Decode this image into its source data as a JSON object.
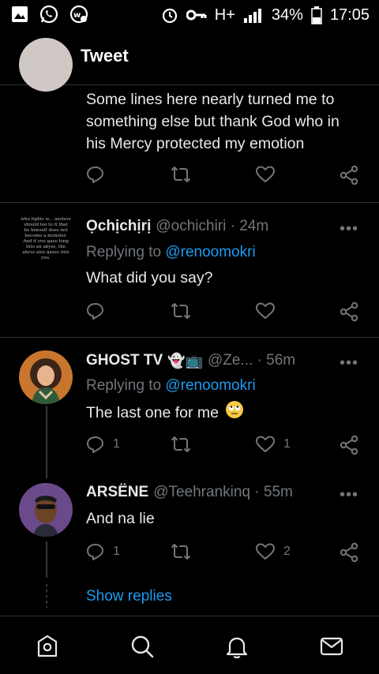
{
  "status_bar": {
    "battery_percent": "34%",
    "time": "17:05",
    "network": "H+"
  },
  "header": {
    "title": "Tweet"
  },
  "tweets": [
    {
      "body": "Some lines here nearly turned me to something else but thank God who in his Mercy protected my emotion"
    },
    {
      "name": "Ọchịchịrị",
      "handle": "@ochichiri · 24m",
      "replying_prefix": "Replying to ",
      "replying_to": "@renoomokri",
      "body": "What did you say?",
      "avatar_text": "who fights w... onsters should loo to it that he himself does not become a monster. And if you gaze long into an abyss, the abyss also gazes into you."
    },
    {
      "name": "GHOST TV",
      "name_emoji": "👻📺",
      "handle": "@Ze... · 56m",
      "replying_prefix": "Replying to ",
      "replying_to": "@renoomokri",
      "body": "The last one for me",
      "reply_count": "1",
      "like_count": "1"
    },
    {
      "name": "ARSËNE",
      "handle": "@Teehrankinq · 55m",
      "body": "And na lie",
      "reply_count": "1",
      "like_count": "2"
    }
  ],
  "more_label": "•••",
  "show_replies": "Show replies",
  "nav": [
    "home-icon",
    "search-icon",
    "notifications-icon",
    "messages-icon"
  ],
  "colors": {
    "accent": "#1d9bf0",
    "muted": "#71767b",
    "text": "#e7e9ea",
    "border": "#2f3336"
  }
}
